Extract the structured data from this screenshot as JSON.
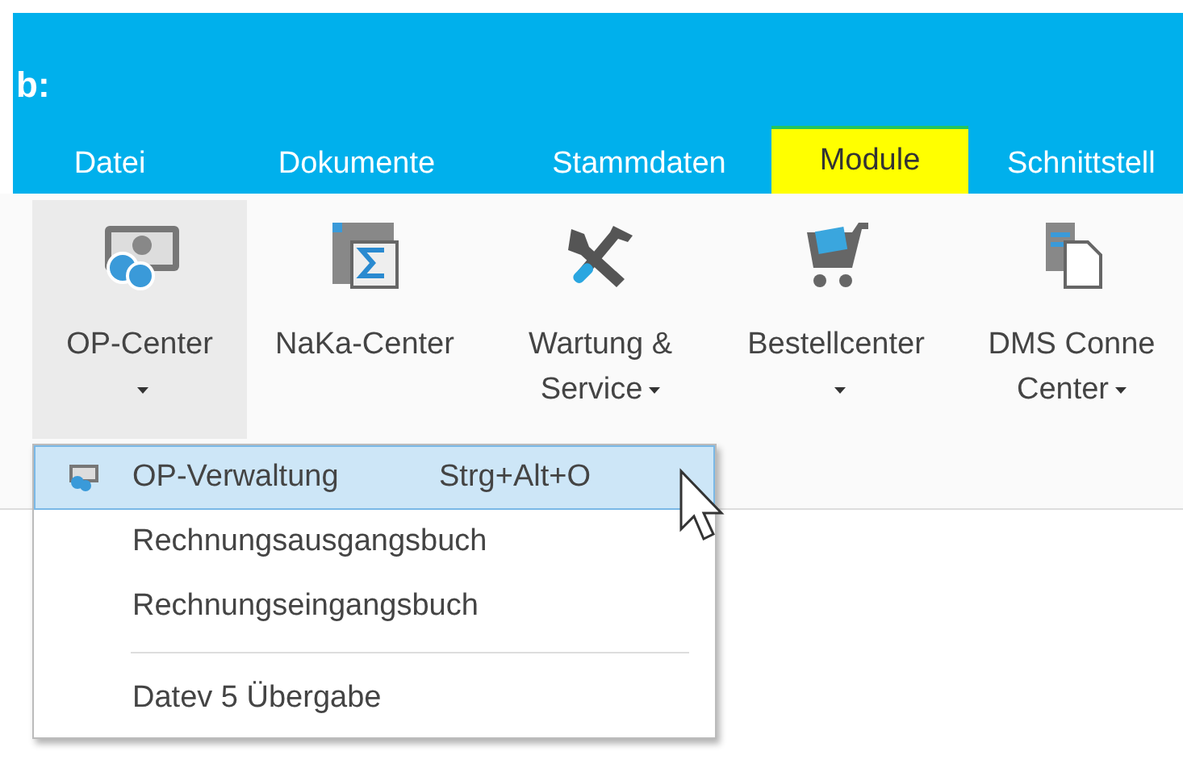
{
  "window": {
    "title": "b:"
  },
  "tabs": [
    {
      "label": "Datei",
      "selected": false
    },
    {
      "label": "Dokumente",
      "selected": false
    },
    {
      "label": "Stammdaten",
      "selected": false
    },
    {
      "label": "Module",
      "selected": true
    },
    {
      "label": "Schnittstell",
      "selected": false
    }
  ],
  "ribbon": {
    "buttons": [
      {
        "kind": "money",
        "lines": [
          "OP-Center"
        ],
        "dropdown": true,
        "pressed": true
      },
      {
        "kind": "sum",
        "lines": [
          "NaKa-Center"
        ],
        "dropdown": false,
        "pressed": false
      },
      {
        "kind": "tools",
        "lines": [
          "Wartung &",
          "Service"
        ],
        "dropdown": true,
        "pressed": false
      },
      {
        "kind": "cart",
        "lines": [
          "Bestellcenter"
        ],
        "dropdown": true,
        "pressed": false
      },
      {
        "kind": "docs",
        "lines": [
          "DMS Conne",
          "Center"
        ],
        "dropdown": true,
        "pressed": false
      }
    ]
  },
  "menu": {
    "items": [
      {
        "label": "OP-Verwaltung",
        "shortcut": "Strg+Alt+O",
        "icon": true,
        "selected": true,
        "separator_before": false
      },
      {
        "label": "Rechnungsausgangsbuch",
        "icon": false,
        "selected": false,
        "separator_before": false
      },
      {
        "label": "Rechnungseingangsbuch",
        "icon": false,
        "selected": false,
        "separator_before": false
      },
      {
        "label": "Datev 5 Übergabe",
        "icon": false,
        "selected": false,
        "separator_before": true
      }
    ]
  }
}
